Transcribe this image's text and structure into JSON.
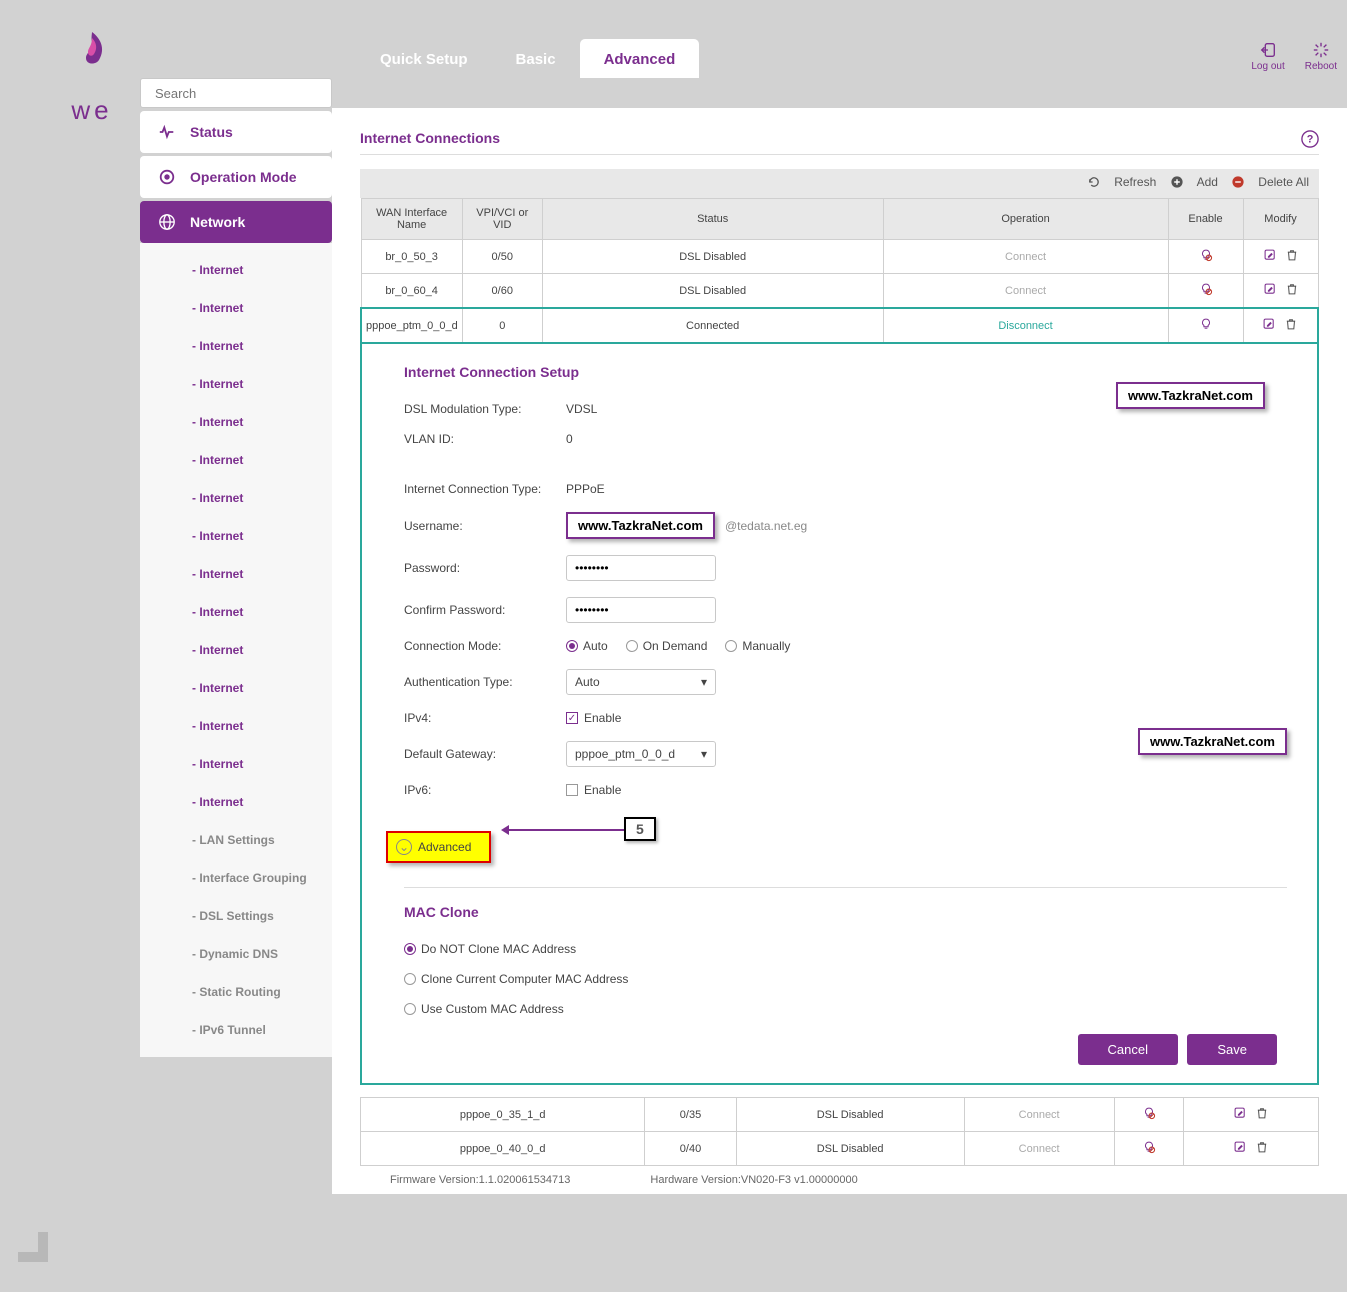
{
  "logo_text": "we",
  "search": {
    "placeholder": "Search"
  },
  "tabs": {
    "quick": "Quick Setup",
    "basic": "Basic",
    "advanced": "Advanced"
  },
  "header_actions": {
    "logout": "Log out",
    "reboot": "Reboot"
  },
  "nav": {
    "status": "Status",
    "op_mode": "Operation Mode",
    "network": "Network"
  },
  "subnav": {
    "internet": "- Internet",
    "lan": "- LAN Settings",
    "ifgrp": "- Interface Grouping",
    "dsl": "- DSL Settings",
    "ddns": "- Dynamic DNS",
    "static": "- Static Routing",
    "ipv6tun": "- IPv6 Tunnel"
  },
  "section_title": "Internet Connections",
  "table_actions": {
    "refresh": "Refresh",
    "add": "Add",
    "delete_all": "Delete All"
  },
  "table_headers": {
    "name": "WAN Interface Name",
    "vpi": "VPI/VCI or VID",
    "status": "Status",
    "operation": "Operation",
    "enable": "Enable",
    "modify": "Modify"
  },
  "rows": [
    {
      "name": "br_0_50_3",
      "vpi": "0/50",
      "status": "DSL Disabled",
      "op": "Connect",
      "op_class": "op-dis"
    },
    {
      "name": "br_0_60_4",
      "vpi": "0/60",
      "status": "DSL Disabled",
      "op": "Connect",
      "op_class": "op-dis"
    },
    {
      "name": "pppoe_ptm_0_0_d",
      "vpi": "0",
      "status": "Connected",
      "op": "Disconnect",
      "op_class": "op-act"
    }
  ],
  "rows2": [
    {
      "name": "pppoe_0_35_1_d",
      "vpi": "0/35",
      "status": "DSL Disabled",
      "op": "Connect",
      "op_class": "op-dis"
    },
    {
      "name": "pppoe_0_40_0_d",
      "vpi": "0/40",
      "status": "DSL Disabled",
      "op": "Connect",
      "op_class": "op-dis"
    }
  ],
  "setup": {
    "title": "Internet Connection Setup",
    "dsl_label": "DSL Modulation Type:",
    "dsl_val": "VDSL",
    "vlan_label": "VLAN ID:",
    "vlan_val": "0",
    "conn_type_label": "Internet Connection Type:",
    "conn_type_val": "PPPoE",
    "user_label": "Username:",
    "user_suffix": "@tedata.net.eg",
    "pass_label": "Password:",
    "pass_val": "••••••••",
    "cpass_label": "Confirm Password:",
    "cpass_val": "••••••••",
    "connmode_label": "Connection Mode:",
    "connmode_auto": "Auto",
    "connmode_demand": "On Demand",
    "connmode_manual": "Manually",
    "auth_label": "Authentication Type:",
    "auth_val": "Auto",
    "ipv4_label": "IPv4:",
    "enable_text": "Enable",
    "gw_label": "Default Gateway:",
    "gw_val": "pppoe_ptm_0_0_d",
    "ipv6_label": "IPv6:",
    "adv_toggle": "Advanced",
    "mac_title": "MAC Clone",
    "mac_noclone": "Do NOT Clone MAC Address",
    "mac_clonecur": "Clone Current Computer MAC Address",
    "mac_custom": "Use Custom MAC Address",
    "cancel": "Cancel",
    "save": "Save"
  },
  "watermark": "www.TazkraNet.com",
  "annotation_num": "5",
  "footer": {
    "fw": "Firmware Version:1.1.020061534713",
    "hw": "Hardware Version:VN020-F3 v1.00000000"
  }
}
